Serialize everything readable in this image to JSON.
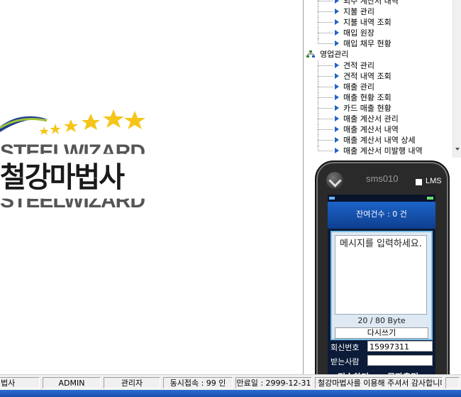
{
  "logo": {
    "top_text": "STEELWIZARD",
    "main_text": "철강마법사",
    "bottom_text": "STEELWIZARD",
    "star_color": "#f5c518"
  },
  "tree": {
    "items_top": [
      {
        "label": "외주 계산서 내역"
      },
      {
        "label": "지불 관리"
      },
      {
        "label": "지불 내역 조회"
      },
      {
        "label": "매입 원장"
      },
      {
        "label": "매입 채무 현황"
      }
    ],
    "group": {
      "label": "영업관리",
      "icon": "tree-group-icon"
    },
    "items_sales": [
      {
        "label": "견적 관리"
      },
      {
        "label": "견적 내역 조회"
      },
      {
        "label": "매출 관리"
      },
      {
        "label": "매출 현황 조회"
      },
      {
        "label": "카드 매출 현황"
      },
      {
        "label": "매출 계산서 관리"
      },
      {
        "label": "매출 계산서 내역"
      },
      {
        "label": "매출 계산서 내역 상세"
      },
      {
        "label": "매출 계산서 미발행 내역"
      }
    ]
  },
  "sms": {
    "title": "sms010",
    "lms_label": "LMS",
    "remaining": "잔여건수 : 0 건",
    "placeholder": "메시지를 입력하세요.",
    "byte_count": "20 / 80 Byte",
    "retype_label": "다시쓰기",
    "reply_label": "회신번호",
    "reply_value": "15997311",
    "recipient_label": "받는사람",
    "recipient_value": "",
    "send_label": "전송하기",
    "charge_label": "문자충전"
  },
  "statusbar": {
    "company": "법사",
    "user": "ADMIN",
    "role": "관리자",
    "concurrent": "동시접속 : 99 인",
    "expire": "만료일 : 2999-12-31",
    "message": "철강마법사를 이용해 주셔서 감사합니다"
  }
}
